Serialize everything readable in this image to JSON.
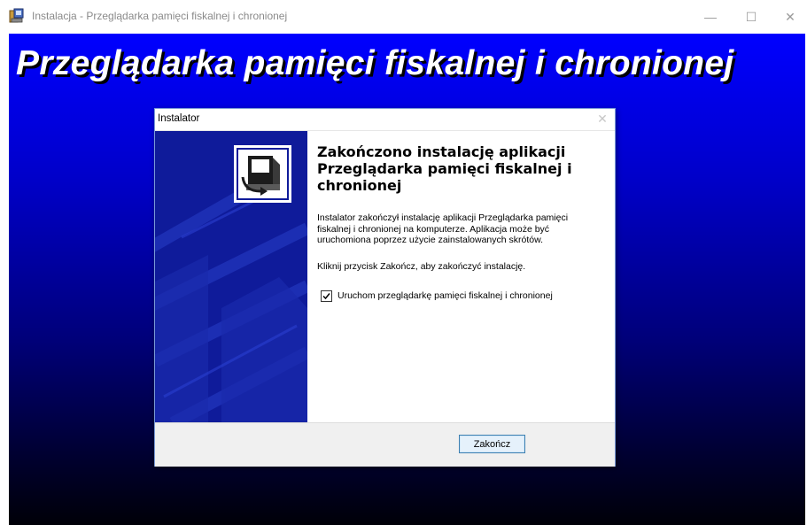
{
  "window": {
    "title": "Instalacja - Przeglądarka pamięci fiskalnej i chronionej",
    "minimize_glyph": "—",
    "maximize_glyph": "☐",
    "close_glyph": "✕"
  },
  "setup": {
    "banner_text": "Przeglądarka pamięci fiskalnej i chronionej",
    "gradient_colors": [
      "#0000ff",
      "#00007a",
      "#000008"
    ]
  },
  "dialog": {
    "title": "Instalator",
    "close_glyph": "✕",
    "heading": "Zakończono instalację aplikacji Przeglądarka pamięci fiskalnej i chronionej",
    "body": "Instalator zakończył instalację aplikacji Przeglądarka pamięci fiskalnej i chronionej na komputerze. Aplikacja może być uruchomiona poprzez użycie zainstalowanych skrótów.",
    "instruction": "Kliknij przycisk Zakończ, aby zakończyć instalację.",
    "launch_checkbox": {
      "label": "Uruchom przeglądarkę pamięci fiskalnej i chronionej",
      "checked": true
    },
    "finish_button": "Zakończ",
    "sidebar_color": "#0f1b9a",
    "sidebar_icon": "installer-computer-icon"
  }
}
